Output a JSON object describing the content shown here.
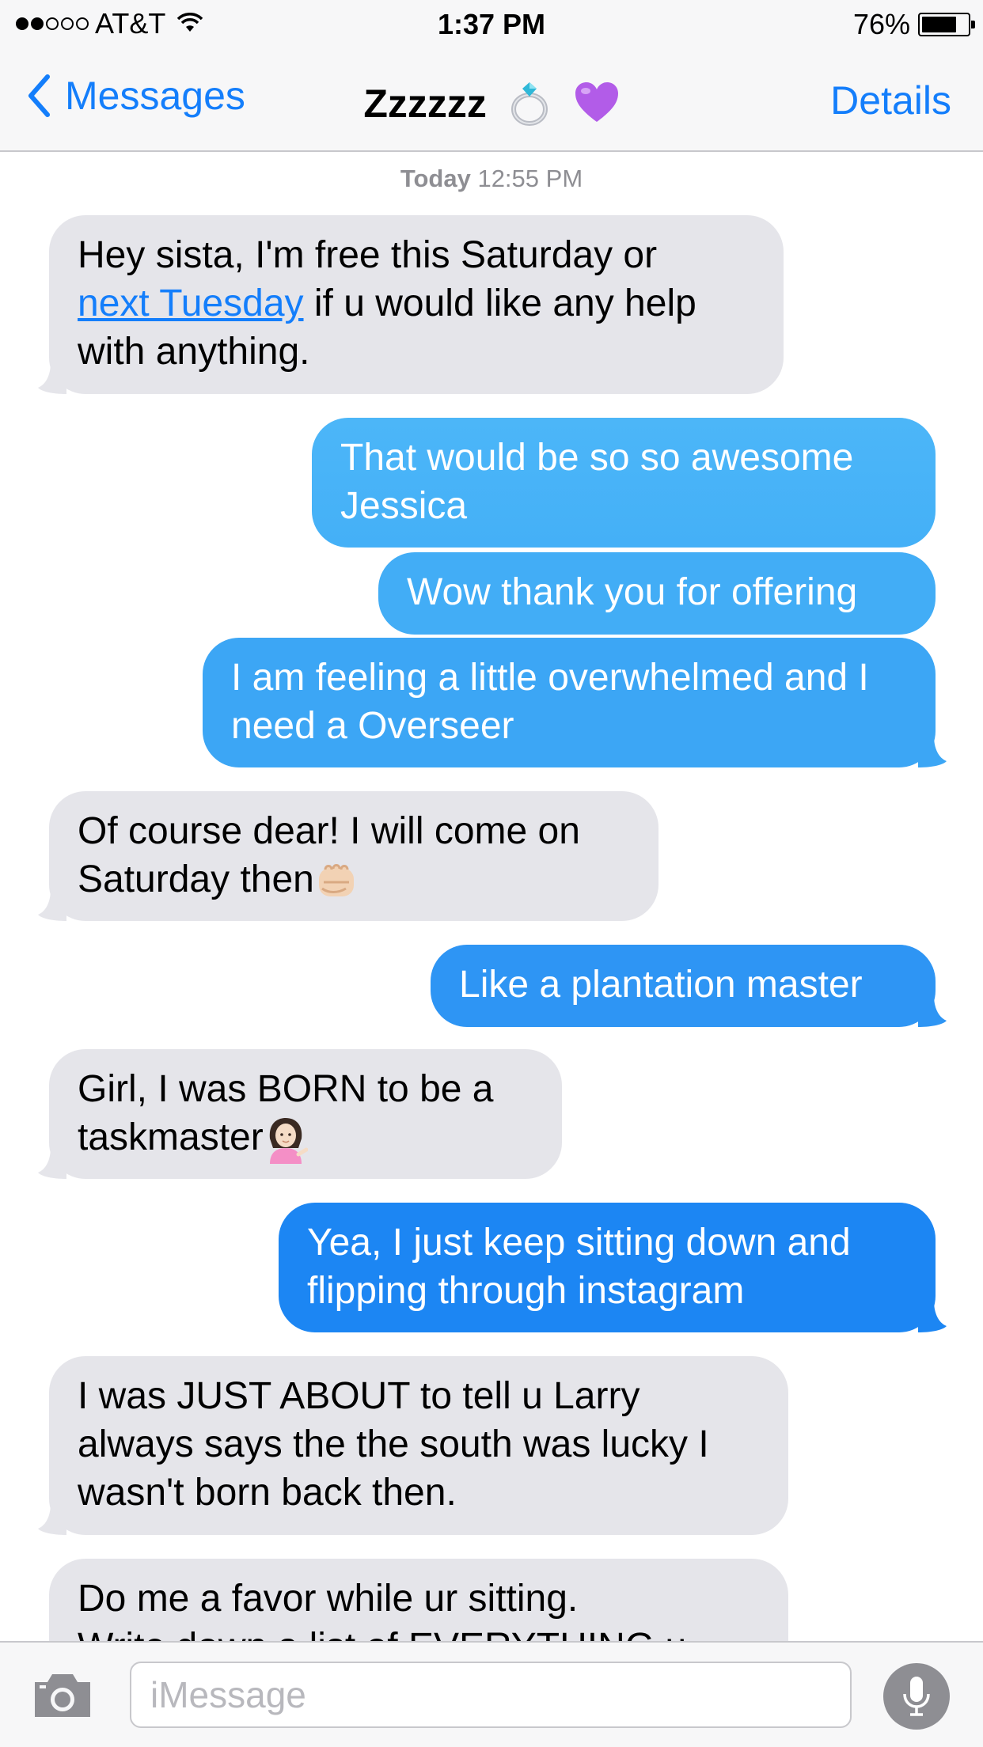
{
  "status_bar": {
    "carrier": "AT&T",
    "signal_bars_filled": 2,
    "signal_bars_total": 5,
    "time": "1:37 PM",
    "battery_percent_text": "76%",
    "battery_level": 0.76,
    "icons": [
      "signal-dots-icon",
      "wifi-icon",
      "battery-icon"
    ]
  },
  "nav": {
    "back_label": "Messages",
    "title": "Zzzzzz",
    "title_emojis": [
      "ring-emoji",
      "purple-heart-emoji"
    ],
    "details_label": "Details",
    "accent_color": "#147efb"
  },
  "conversation": {
    "timestamp_day": "Today",
    "timestamp_time": "12:55 PM",
    "messages": [
      {
        "direction": "incoming",
        "line1": "Hey sista, I'm free this Saturday or",
        "link": "next Tuesday",
        "line2_rest": " if u would like any help",
        "line3": "with anything."
      },
      {
        "direction": "outgoing",
        "text": "That would be so so awesome Jessica"
      },
      {
        "direction": "outgoing",
        "text": "Wow thank you for offering"
      },
      {
        "direction": "outgoing",
        "text": "I am feeling a little overwhelmed and I need a Overseer"
      },
      {
        "direction": "incoming",
        "text": "Of course dear! I will come on Saturday then",
        "emoji": "fist-bump-emoji"
      },
      {
        "direction": "outgoing",
        "text": "Like a plantation master"
      },
      {
        "direction": "incoming",
        "text": "Girl, I was BORN to be a taskmaster",
        "emoji": "information-desk-person-emoji"
      },
      {
        "direction": "outgoing",
        "text": "Yea, I just keep sitting down and flipping through instagram"
      },
      {
        "direction": "incoming",
        "text": "I was JUST ABOUT to tell u Larry always says the the south was lucky I wasn't born back then."
      },
      {
        "direction": "incoming",
        "line1": "Do me a favor while ur sitting.",
        "line2": "Write down a list of EVERYTHING u"
      }
    ],
    "incoming_color": "#e5e5ea",
    "outgoing_color_top": "#5ac8fa",
    "outgoing_color_bottom": "#147efb"
  },
  "input_bar": {
    "placeholder": "iMessage",
    "value": "",
    "icons": [
      "camera-icon",
      "microphone-icon"
    ]
  }
}
